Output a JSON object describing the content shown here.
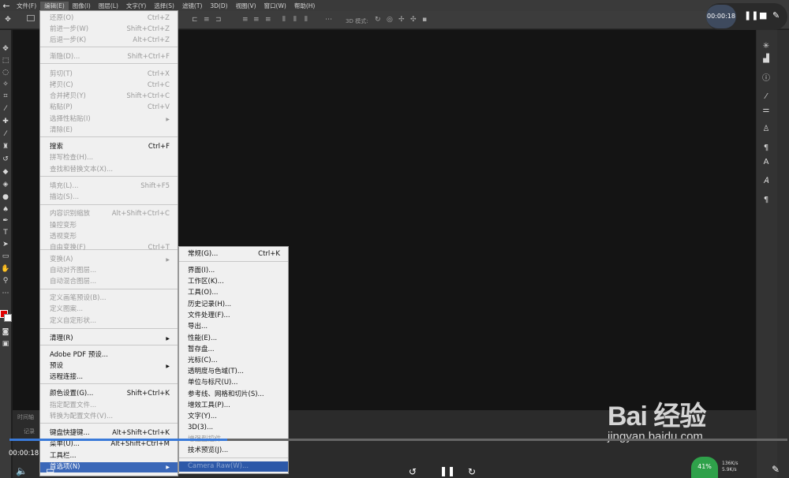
{
  "menubar": {
    "items": [
      "文件(F)",
      "编辑(E)",
      "图像(I)",
      "图层(L)",
      "文字(Y)",
      "选择(S)",
      "滤镜(T)",
      "3D(D)",
      "视图(V)",
      "窗口(W)",
      "帮助(H)"
    ]
  },
  "options_bar": {
    "mode_3d_label": "3D 模式:"
  },
  "recorder": {
    "time": "00:00:18"
  },
  "edit_menu": {
    "items": [
      {
        "label": "还原(O)",
        "shortcut": "Ctrl+Z",
        "disabled": true
      },
      {
        "label": "前进一步(W)",
        "shortcut": "Shift+Ctrl+Z",
        "disabled": true
      },
      {
        "label": "后退一步(K)",
        "shortcut": "Alt+Ctrl+Z",
        "disabled": true
      },
      {
        "label": "渐隐(D)...",
        "shortcut": "Shift+Ctrl+F",
        "disabled": true
      },
      {
        "label": "剪切(T)",
        "shortcut": "Ctrl+X",
        "disabled": true
      },
      {
        "label": "拷贝(C)",
        "shortcut": "Ctrl+C",
        "disabled": true
      },
      {
        "label": "合并拷贝(Y)",
        "shortcut": "Shift+Ctrl+C",
        "disabled": true
      },
      {
        "label": "粘贴(P)",
        "shortcut": "Ctrl+V",
        "disabled": true
      },
      {
        "label": "选择性粘贴(I)",
        "shortcut": "",
        "disabled": true,
        "submenu": true
      },
      {
        "label": "清除(E)",
        "shortcut": "",
        "disabled": true
      },
      {
        "label": "搜索",
        "shortcut": "Ctrl+F",
        "disabled": false
      },
      {
        "label": "拼写检查(H)...",
        "shortcut": "",
        "disabled": true
      },
      {
        "label": "查找和替换文本(X)...",
        "shortcut": "",
        "disabled": true
      },
      {
        "label": "填充(L)...",
        "shortcut": "Shift+F5",
        "disabled": true
      },
      {
        "label": "描边(S)...",
        "shortcut": "",
        "disabled": true
      },
      {
        "label": "内容识别缩放",
        "shortcut": "Alt+Shift+Ctrl+C",
        "disabled": true
      },
      {
        "label": "操控变形",
        "shortcut": "",
        "disabled": true
      },
      {
        "label": "透视变形",
        "shortcut": "",
        "disabled": true
      },
      {
        "label": "自由变换(F)",
        "shortcut": "Ctrl+T",
        "disabled": true
      },
      {
        "label": "变换(A)",
        "shortcut": "",
        "disabled": true,
        "submenu": true
      },
      {
        "label": "自动对齐图层...",
        "shortcut": "",
        "disabled": true
      },
      {
        "label": "自动混合图层...",
        "shortcut": "",
        "disabled": true
      },
      {
        "label": "定义画笔预设(B)...",
        "shortcut": "",
        "disabled": true
      },
      {
        "label": "定义图案...",
        "shortcut": "",
        "disabled": true
      },
      {
        "label": "定义自定形状...",
        "shortcut": "",
        "disabled": true
      },
      {
        "label": "清理(R)",
        "shortcut": "",
        "disabled": false,
        "submenu": true
      },
      {
        "label": "Adobe PDF 预设...",
        "shortcut": "",
        "disabled": false
      },
      {
        "label": "预设",
        "shortcut": "",
        "disabled": false,
        "submenu": true
      },
      {
        "label": "远程连接...",
        "shortcut": "",
        "disabled": false
      },
      {
        "label": "颜色设置(G)...",
        "shortcut": "Shift+Ctrl+K",
        "disabled": false
      },
      {
        "label": "指定配置文件...",
        "shortcut": "",
        "disabled": true
      },
      {
        "label": "转换为配置文件(V)...",
        "shortcut": "",
        "disabled": true
      },
      {
        "label": "键盘快捷键...",
        "shortcut": "Alt+Shift+Ctrl+K",
        "disabled": false
      },
      {
        "label": "菜单(U)...",
        "shortcut": "Alt+Shift+Ctrl+M",
        "disabled": false
      },
      {
        "label": "工具栏...",
        "shortcut": "",
        "disabled": false
      },
      {
        "label": "首选项(N)",
        "shortcut": "",
        "disabled": false,
        "submenu": true,
        "highlighted": true
      }
    ]
  },
  "preferences_menu": {
    "items": [
      {
        "label": "常规(G)...",
        "shortcut": "Ctrl+K",
        "disabled": false
      },
      {
        "label": "界面(I)...",
        "shortcut": "",
        "disabled": false
      },
      {
        "label": "工作区(K)...",
        "shortcut": "",
        "disabled": false
      },
      {
        "label": "工具(O)...",
        "shortcut": "",
        "disabled": false
      },
      {
        "label": "历史记录(H)...",
        "shortcut": "",
        "disabled": false
      },
      {
        "label": "文件处理(F)...",
        "shortcut": "",
        "disabled": false
      },
      {
        "label": "导出...",
        "shortcut": "",
        "disabled": false
      },
      {
        "label": "性能(E)...",
        "shortcut": "",
        "disabled": false
      },
      {
        "label": "暂存盘...",
        "shortcut": "",
        "disabled": false
      },
      {
        "label": "光标(C)...",
        "shortcut": "",
        "disabled": false
      },
      {
        "label": "透明度与色域(T)...",
        "shortcut": "",
        "disabled": false
      },
      {
        "label": "单位与标尺(U)...",
        "shortcut": "",
        "disabled": false
      },
      {
        "label": "参考线、网格和切片(S)...",
        "shortcut": "",
        "disabled": false
      },
      {
        "label": "增效工具(P)...",
        "shortcut": "",
        "disabled": false
      },
      {
        "label": "文字(Y)...",
        "shortcut": "",
        "disabled": false
      },
      {
        "label": "3D(3)...",
        "shortcut": "",
        "disabled": false
      },
      {
        "label": "增强型控件...",
        "shortcut": "",
        "disabled": true
      },
      {
        "label": "技术预览(J)...",
        "shortcut": "",
        "disabled": false
      },
      {
        "label": "Camera Raw(W)...",
        "shortcut": "",
        "disabled": false,
        "highlighted": true
      }
    ]
  },
  "bottom_panel": {
    "tab1": "时间轴",
    "tab2": "记录"
  },
  "player": {
    "current_time": "00:00:18",
    "progress_fraction": 0.28,
    "cpu": "41%",
    "net_up": "136K/s",
    "net_down": "5.9K/s"
  },
  "watermark": {
    "logo": "Bai 经验",
    "url": "jingyan.baidu.com"
  },
  "colors": {
    "menu_highlight": "#3a67b8",
    "progress": "#3a7ad9",
    "cpu_badge": "#2fa14a"
  }
}
